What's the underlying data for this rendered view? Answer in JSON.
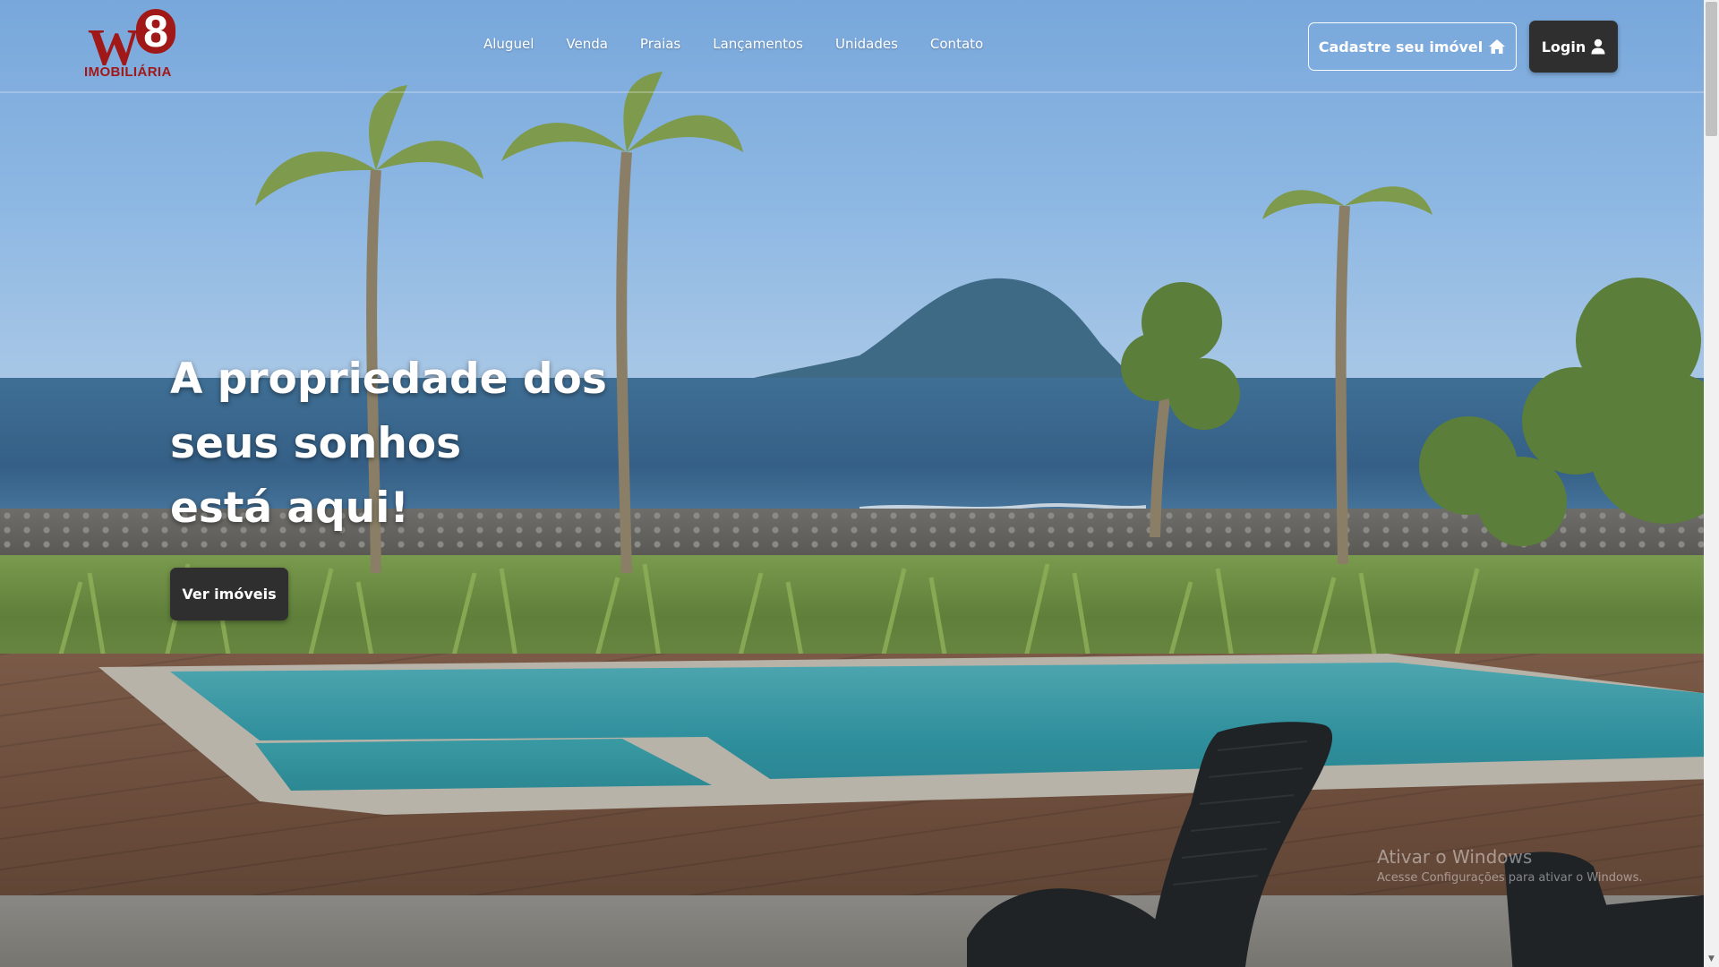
{
  "brand": {
    "logo_mark_w": "W",
    "logo_mark_8": "8",
    "logo_text": "IMOBILIÁRIA",
    "primary_color": "#a01818"
  },
  "nav": {
    "items": [
      {
        "label": "Aluguel"
      },
      {
        "label": "Venda"
      },
      {
        "label": "Praias"
      },
      {
        "label": "Lançamentos"
      },
      {
        "label": "Unidades"
      },
      {
        "label": "Contato"
      }
    ]
  },
  "header_actions": {
    "cadastre_label": "Cadastre seu imóvel",
    "cadastre_icon": "home-icon",
    "login_label": "Login",
    "login_icon": "user-icon",
    "button_dark_color": "#2f2f2f"
  },
  "hero": {
    "title_lines": [
      "A propriedade dos",
      "seus sonhos",
      "está aqui!"
    ],
    "cta_label": "Ver imóveis"
  },
  "watermark": {
    "title": "Ativar o Windows",
    "subtitle": "Acesse Configurações para ativar o Windows."
  }
}
